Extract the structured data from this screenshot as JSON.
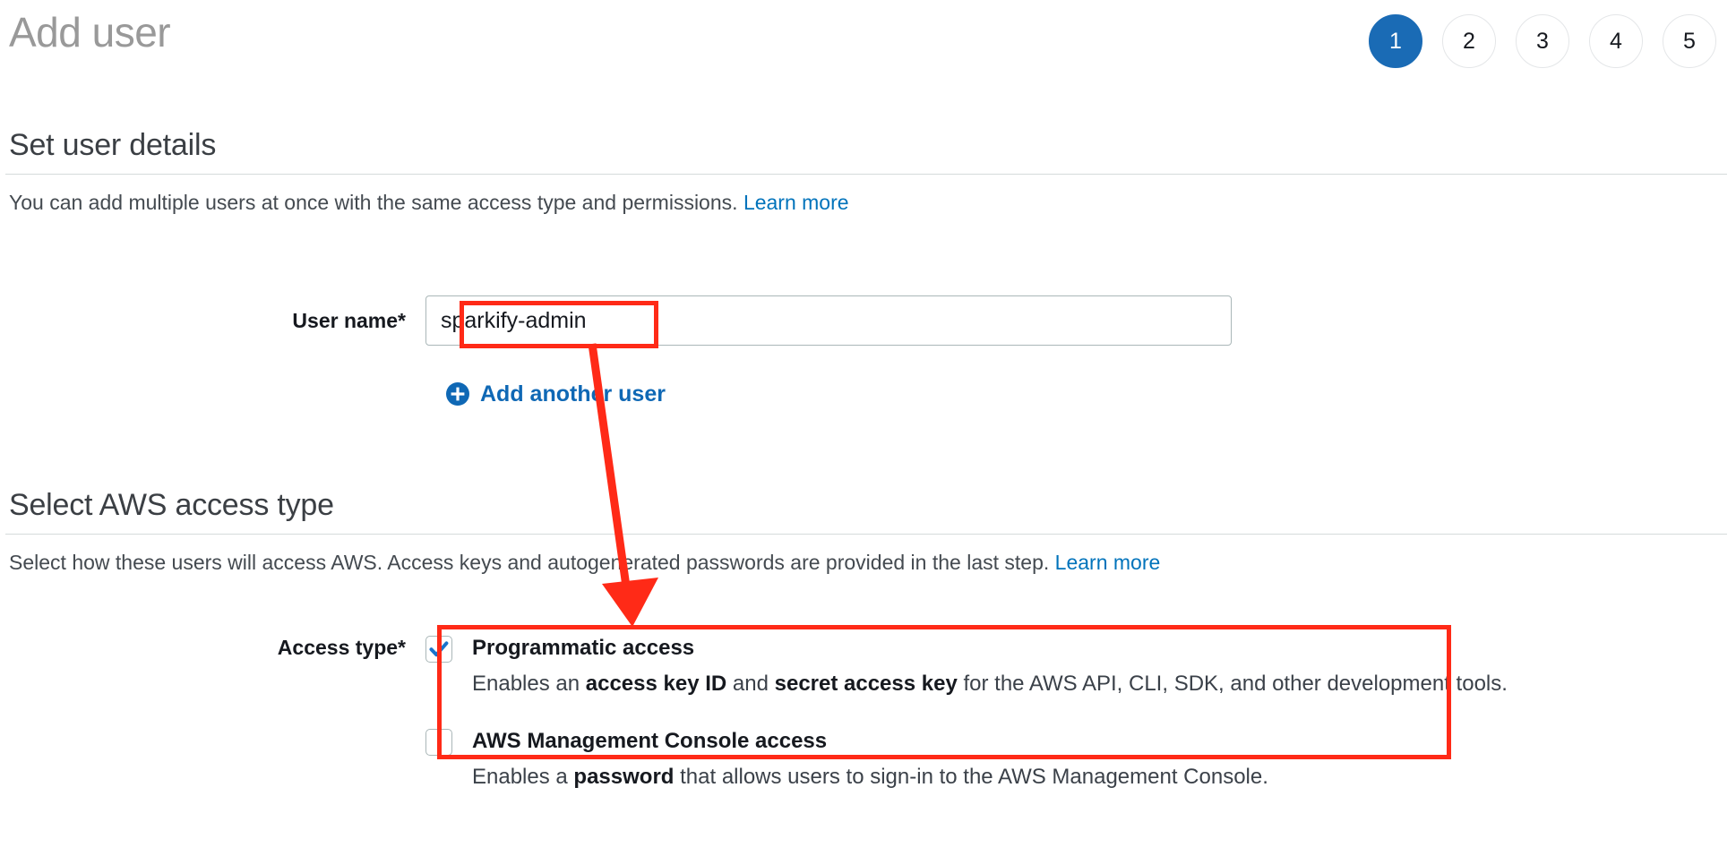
{
  "header": {
    "title": "Add user",
    "steps": [
      {
        "number": "1",
        "active": true
      },
      {
        "number": "2",
        "active": false
      },
      {
        "number": "3",
        "active": false
      },
      {
        "number": "4",
        "active": false
      },
      {
        "number": "5",
        "active": false
      }
    ]
  },
  "user_details": {
    "heading": "Set user details",
    "description": "You can add multiple users at once with the same access type and permissions.",
    "learn_more": "Learn more",
    "username_label": "User name*",
    "username_value": "sparkify-admin",
    "username_placeholder": "",
    "add_another_label": "Add another user",
    "add_another_icon": "plus-circle-icon"
  },
  "access_type": {
    "heading": "Select AWS access type",
    "description": "Select how these users will access AWS. Access keys and autogenerated passwords are provided in the last step.",
    "learn_more": "Learn more",
    "label": "Access type*",
    "options": [
      {
        "title": "Programmatic access",
        "checked": true,
        "desc_part_1": "Enables an ",
        "desc_bold_1": "access key ID",
        "desc_part_2": " and ",
        "desc_bold_2": "secret access key",
        "desc_part_3": " for the AWS API, CLI, SDK, and other development tools."
      },
      {
        "title": "AWS Management Console access",
        "checked": false,
        "desc_part_1": "Enables a ",
        "desc_bold_1": "password",
        "desc_part_2": "",
        "desc_bold_2": "",
        "desc_part_3": " that allows users to sign-in to the AWS Management Console."
      }
    ]
  },
  "annotations": {
    "color": "#ff2a17",
    "arrow_from": "user name input",
    "arrow_to": "programmatic access checkbox"
  },
  "colors": {
    "accent_blue": "#1a6bb5",
    "link_blue": "#0073bb",
    "annotation_red": "#ff2a17",
    "title_gray": "#999999"
  }
}
